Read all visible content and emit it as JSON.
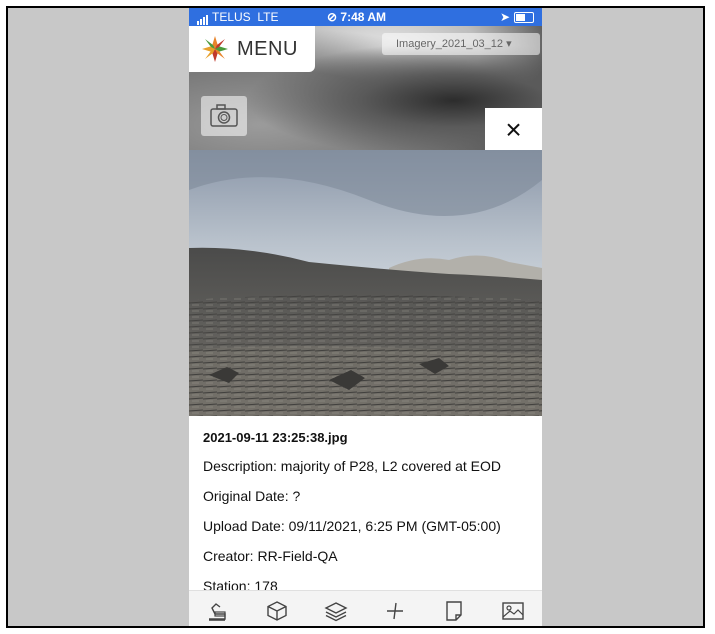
{
  "status_bar": {
    "carrier": "TELUS",
    "network": "LTE",
    "time": "7:48 AM"
  },
  "header": {
    "menu_label": "MENU",
    "imagery_select": "Imagery_2021_03_12"
  },
  "close_label": "×",
  "photo_info": {
    "filename": "2021-09-11 23:25:38.jpg",
    "description": "Description: majority of P28, L2 covered at EOD",
    "original_date": "Original Date: ?",
    "upload_date": "Upload Date: 09/11/2021, 6:25 PM (GMT-05:00)",
    "creator": "Creator: RR-Field-QA",
    "station": "Station: 178"
  },
  "toolbar": {
    "icons": [
      "excavator-icon",
      "cube-icon",
      "layers-icon",
      "measure-icon",
      "note-icon",
      "image-icon"
    ]
  },
  "colors": {
    "status_bar": "#2f6fe0",
    "logo_orange": "#e8842a",
    "logo_green": "#4a9a3c",
    "logo_red": "#c0392b"
  }
}
